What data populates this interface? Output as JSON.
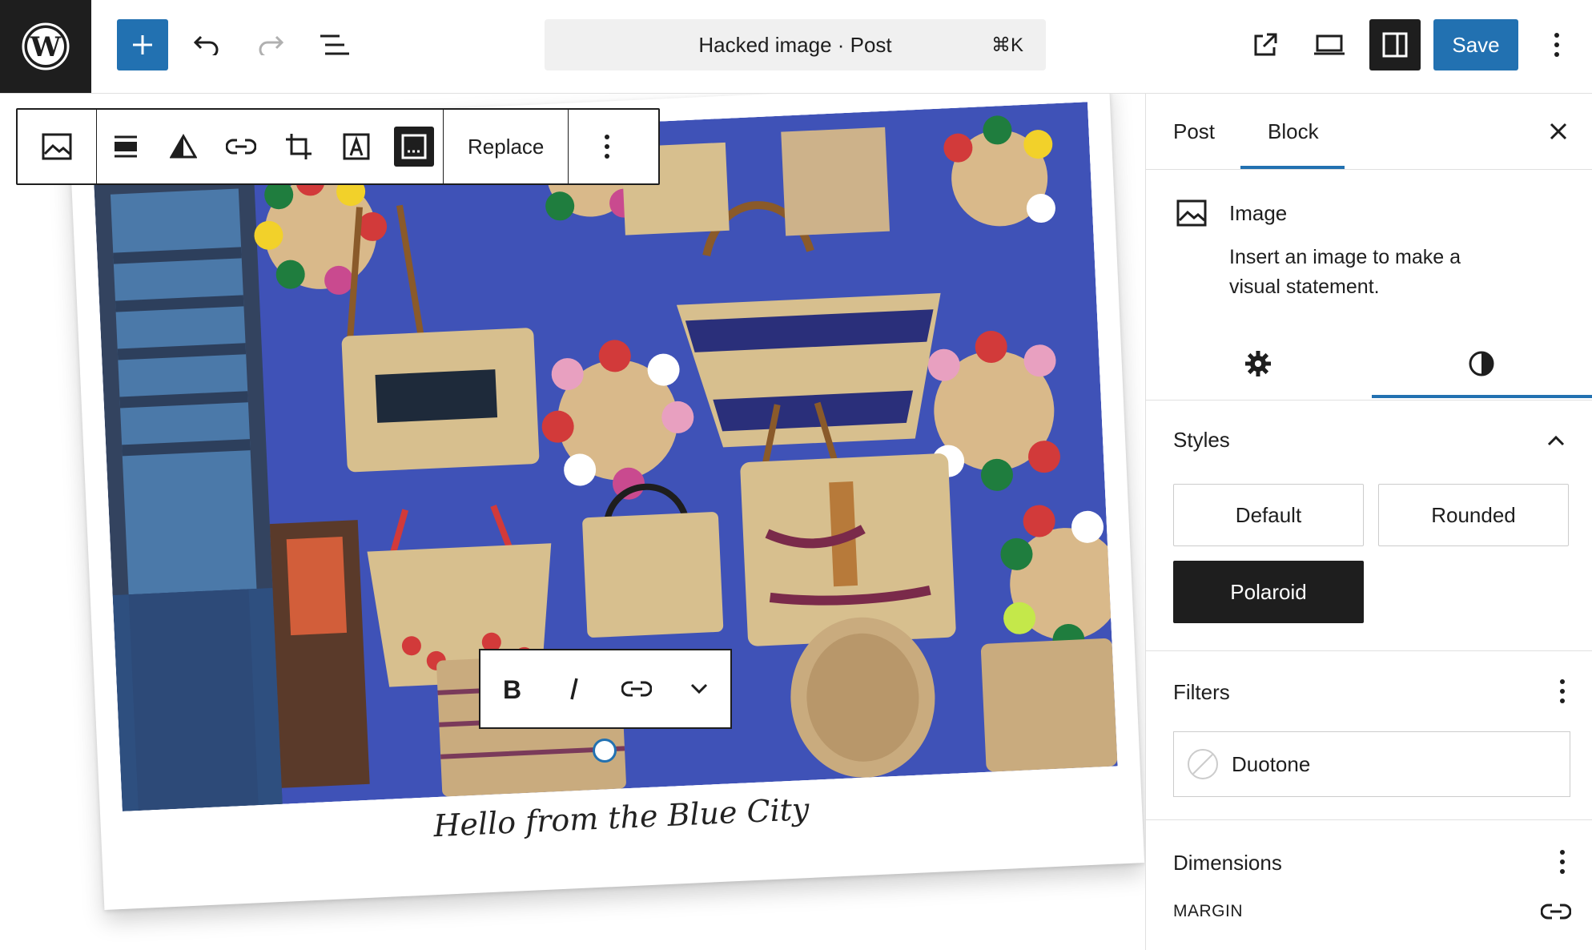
{
  "topbar": {
    "document_title": "Hacked image · Post",
    "shortcut": "⌘K",
    "save_label": "Save"
  },
  "block_toolbar": {
    "replace_label": "Replace"
  },
  "caption": "Hello from the Blue City",
  "sidebar": {
    "tabs": [
      {
        "label": "Post"
      },
      {
        "label": "Block"
      }
    ],
    "block_card": {
      "title": "Image",
      "description_line1": "Insert an image to make a",
      "description_line2": "visual statement."
    },
    "styles": {
      "title": "Styles",
      "options": [
        "Default",
        "Rounded",
        "Polaroid"
      ],
      "selected": "Polaroid"
    },
    "filters": {
      "title": "Filters",
      "duotone_label": "Duotone"
    },
    "dimensions": {
      "title": "Dimensions",
      "margin_label": "MARGIN"
    }
  },
  "colors": {
    "accent": "#2271b1",
    "dark": "#1e1e1e",
    "photo_bg": "#3f52b7"
  }
}
